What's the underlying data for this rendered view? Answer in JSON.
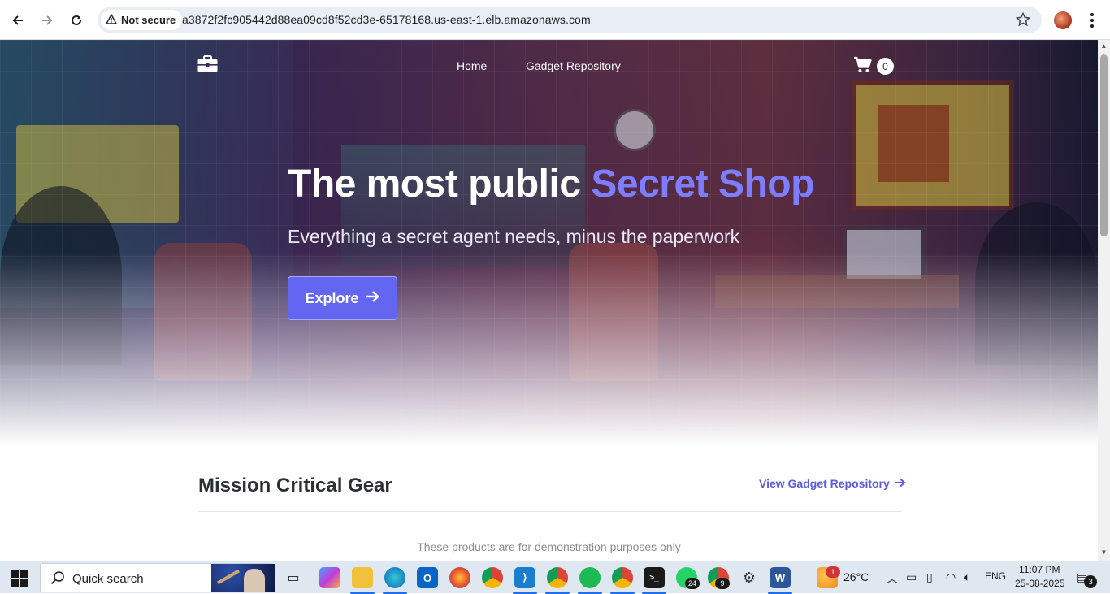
{
  "browser": {
    "security_label": "Not secure",
    "url": "a3872f2fc905442d88ea09cd8f52cd3e-65178168.us-east-1.elb.amazonaws.com"
  },
  "nav": {
    "links": [
      "Home",
      "Gadget Repository"
    ],
    "cart_count": "0"
  },
  "hero": {
    "title_plain": "The most public ",
    "title_accent": "Secret Shop",
    "subtitle": "Everything a secret agent needs, minus the paperwork",
    "cta_label": "Explore"
  },
  "products": {
    "title": "Mission Critical Gear",
    "view_all_label": "View Gadget Repository",
    "note": "These products are for demonstration purposes only"
  },
  "taskbar": {
    "search_placeholder": "Quick search",
    "temperature": "26°C",
    "language": "ENG",
    "time": "11:07 PM",
    "date": "25-08-2025",
    "notification_count": "3",
    "whatsapp_badge": "24",
    "chrome_badge": "9",
    "weather_badge": "1"
  },
  "colors": {
    "accent": "#6366f1",
    "accent_text": "#7f7dff",
    "link": "#5b5ce0"
  }
}
